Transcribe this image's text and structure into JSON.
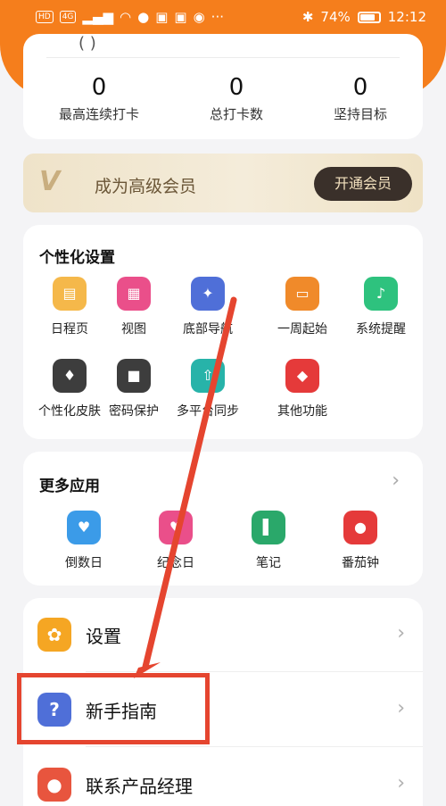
{
  "status_bar": {
    "left_chips": [
      "HD",
      "4G"
    ],
    "battery": "74%",
    "battery_level": 0.74,
    "time": "12:12"
  },
  "stats": {
    "items": [
      {
        "value": "0",
        "label": "最高连续打卡"
      },
      {
        "value": "0",
        "label": "总打卡数"
      },
      {
        "value": "0",
        "label": "坚持目标"
      }
    ]
  },
  "vip": {
    "logo": "V",
    "text": "成为高级会员",
    "button": "开通会员"
  },
  "personalization": {
    "title": "个性化设置",
    "items": [
      {
        "label": "日程页",
        "icon": "schedule-page-icon",
        "color": "#f5b84a",
        "glyph": "▤"
      },
      {
        "label": "视图",
        "icon": "grid-view-icon",
        "color": "#ea4f8a",
        "glyph": "▦"
      },
      {
        "label": "底部导航",
        "icon": "compass-icon",
        "color": "#4f6fd8",
        "glyph": "✦"
      },
      {
        "label": "一周起始",
        "icon": "calendar-icon",
        "color": "#f08a2a",
        "glyph": "▭"
      },
      {
        "label": "系统提醒",
        "icon": "bell-icon",
        "color": "#2ec27e",
        "glyph": "♪"
      },
      {
        "label": "个性化皮肤",
        "icon": "tshirt-icon",
        "color": "#3d3d3d",
        "glyph": "♦"
      },
      {
        "label": "密码保护",
        "icon": "lock-icon",
        "color": "#3d3d3d",
        "glyph": "■"
      },
      {
        "label": "多平台同步",
        "icon": "cloud-sync-icon",
        "color": "#27b3a9",
        "glyph": "⇧"
      },
      {
        "label": "其他功能",
        "icon": "apps-icon",
        "color": "#e53a3a",
        "glyph": "◆"
      }
    ]
  },
  "more_apps": {
    "title": "更多应用",
    "arrow": "›",
    "items": [
      {
        "label": "倒数日",
        "icon": "countdown-icon",
        "color": "#3b9be8",
        "glyph": "♥"
      },
      {
        "label": "纪念日",
        "icon": "anniversary-icon",
        "color": "#ea4f8a",
        "glyph": "♥"
      },
      {
        "label": "笔记",
        "icon": "notebook-icon",
        "color": "#2aa86a",
        "glyph": "▌"
      },
      {
        "label": "番茄钟",
        "icon": "tomato-icon",
        "color": "#e53a3a",
        "glyph": "●"
      }
    ]
  },
  "menu": {
    "items": [
      {
        "label": "设置",
        "icon": "gear-icon",
        "color": "#f5a623",
        "glyph": "✿"
      },
      {
        "label": "新手指南",
        "icon": "question-icon",
        "color": "#4f6fd8",
        "glyph": "?"
      },
      {
        "label": "联系产品经理",
        "icon": "contact-person-icon",
        "color": "#e8553e",
        "glyph": "●"
      }
    ],
    "arrow": "›"
  },
  "annotation_colors": {
    "arrow": "#e5452f",
    "box": "#e5452f"
  }
}
